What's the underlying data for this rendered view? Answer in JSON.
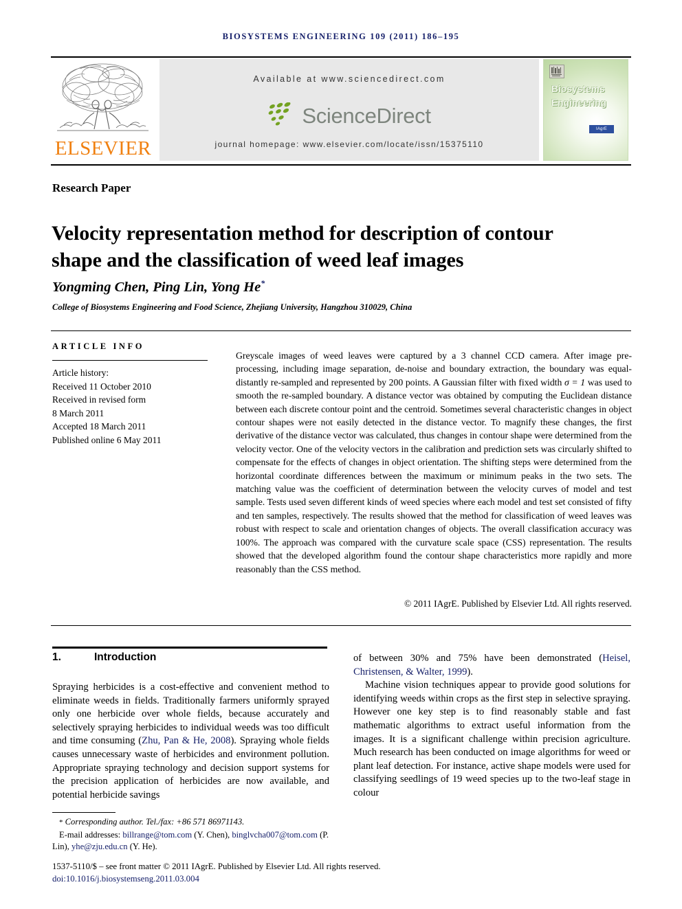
{
  "running_head": "Biosystems Engineering 109 (2011) 186–195",
  "header": {
    "publisher_name": "ELSEVIER",
    "available_at": "Available at www.sciencedirect.com",
    "sciencedirect_wordmark": "ScienceDirect",
    "journal_homepage": "journal homepage: www.elsevier.com/locate/issn/15375110",
    "cover": {
      "title_line1": "Biosystems",
      "title_line2": "Engineering",
      "badge": "IAgrE"
    }
  },
  "article": {
    "kind": "Research Paper",
    "title": "Velocity representation method for description of contour shape and the classification of weed leaf images",
    "authors": "Yongming Chen, Ping Lin, Yong He",
    "author_marker": "*",
    "affiliation": "College of Biosystems Engineering and Food Science, Zhejiang University, Hangzhou 310029, China"
  },
  "article_info": {
    "heading": "ARTICLE INFO",
    "history_label": "Article history:",
    "history": [
      "Received 11 October 2010",
      "Received in revised form",
      "8 March 2011",
      "Accepted 18 March 2011",
      "Published online 6 May 2011"
    ]
  },
  "abstract": {
    "part1": "Greyscale images of weed leaves were captured by a 3 channel CCD camera. After image pre-processing, including image separation, de-noise and boundary extraction, the boundary was equal-distantly re-sampled and represented by 200 points. A Gaussian filter with fixed width ",
    "sigma": "σ = 1",
    "part2": " was used to smooth the re-sampled boundary. A distance vector was obtained by computing the Euclidean distance between each discrete contour point and the centroid. Sometimes several characteristic changes in object contour shapes were not easily detected in the distance vector. To magnify these changes, the first derivative of the distance vector was calculated, thus changes in contour shape were determined from the velocity vector. One of the velocity vectors in the calibration and prediction sets was circularly shifted to compensate for the effects of changes in object orientation. The shifting steps were determined from the horizontal coordinate differences between the maximum or minimum peaks in the two sets. The matching value was the coefficient of determination between the velocity curves of model and test sample. Tests used seven different kinds of weed species where each model and test set consisted of fifty and ten samples, respectively. The results showed that the method for classification of weed leaves was robust with respect to scale and orientation changes of objects. The overall classification accuracy was 100%. The approach was compared with the curvature scale space (CSS) representation. The results showed that the developed algorithm found the contour shape characteristics more rapidly and more reasonably than the CSS method.",
    "copyright": "© 2011 IAgrE. Published by Elsevier Ltd. All rights reserved."
  },
  "section": {
    "number": "1.",
    "title": "Introduction"
  },
  "body": {
    "left_p1_a": "Spraying herbicides is a cost-effective and convenient method to eliminate weeds in fields. Traditionally farmers uniformly sprayed only one herbicide over whole fields, because accurately and selectively spraying herbicides to individual weeds was too difficult and time consuming (",
    "left_p1_ref": "Zhu, Pan & He, 2008",
    "left_p1_b": "). Spraying whole fields causes unnecessary waste of herbicides and environment pollution. Appropriate spraying technology and decision support systems for the precision application of herbicides are now available, and potential herbicide savings",
    "right_p1_a": "of between 30% and 75% have been demonstrated (",
    "right_p1_ref": "Heisel, Christensen, & Walter, 1999",
    "right_p1_b": ").",
    "right_p2": "Machine vision techniques appear to provide good solutions for identifying weeds within crops as the first step in selective spraying. However one key step is to find reasonably stable and fast mathematic algorithms to extract useful information from the images. It is a significant challenge within precision agriculture. Much research has been conducted on image algorithms for weed or plant leaf detection. For instance, active shape models were used for classifying seedlings of 19 weed species up to the two-leaf stage in colour"
  },
  "footnotes": {
    "corresponding": "Corresponding author. Tel./fax: +86 571 86971143.",
    "email_label": "E-mail addresses:",
    "emails": [
      {
        "address": "billrange@tom.com",
        "who": "(Y. Chen),"
      },
      {
        "address": "binglvcha007@tom.com",
        "who": "(P. Lin),"
      },
      {
        "address": "yhe@zju.edu.cn",
        "who": "(Y. He)."
      }
    ],
    "frontmatter": "1537-5110/$ – see front matter © 2011 IAgrE. Published by Elsevier Ltd. All rights reserved.",
    "doi": "doi:10.1016/j.biosystemseng.2011.03.004"
  },
  "colors": {
    "link_blue": "#16206a",
    "elsevier_orange": "#f08010",
    "sciencedirect_grey": "#7d857d",
    "sciencedirect_green": "#74a221",
    "banner_grey": "#e8e8e8"
  }
}
